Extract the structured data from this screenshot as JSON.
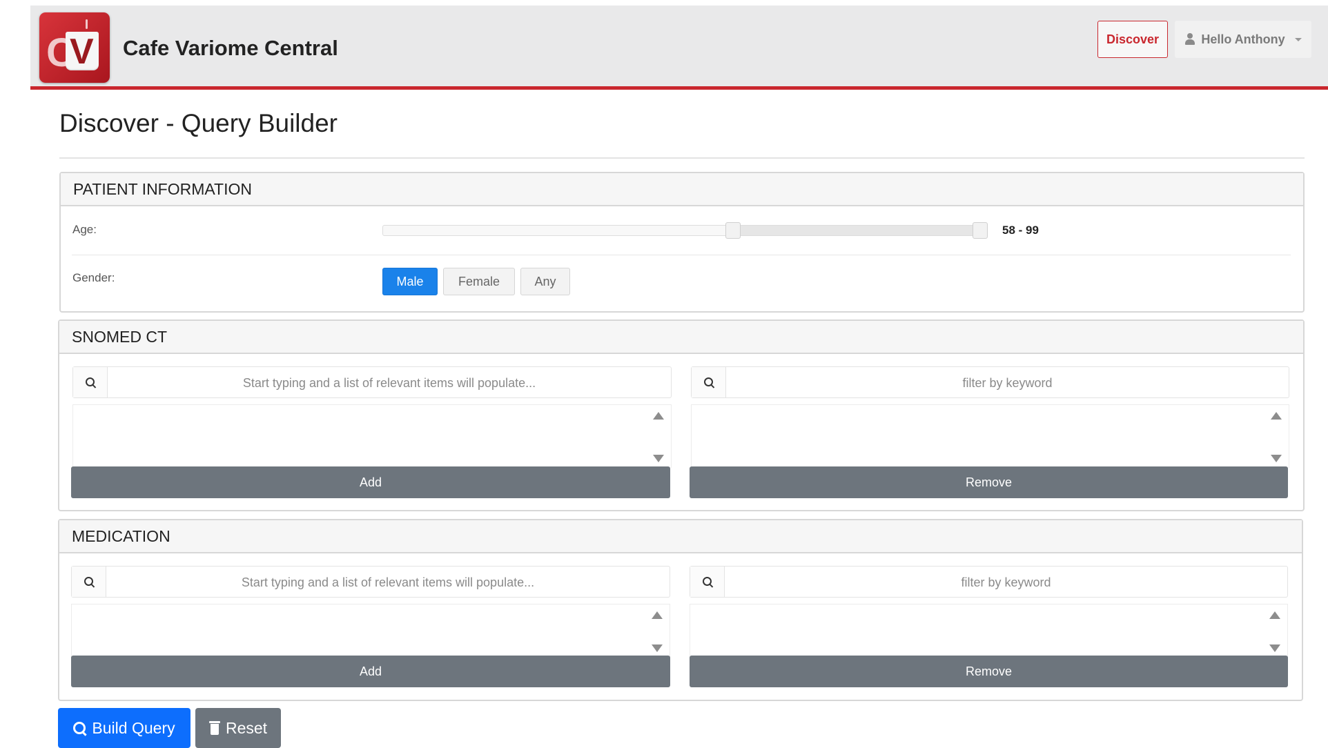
{
  "app": {
    "title": "Cafe Variome Central",
    "logo_text": "CV"
  },
  "navbar": {
    "discover_label": "Discover",
    "user_label": "Hello Anthony"
  },
  "page": {
    "title": "Discover - Query Builder"
  },
  "patient_info": {
    "header": "PATIENT INFORMATION",
    "age_label": "Age:",
    "age_min": 58,
    "age_max": 99,
    "slider_min": 0,
    "slider_max": 100,
    "age_value_text": "58 - 99",
    "gender_label": "Gender:",
    "gender_options": [
      "Male",
      "Female",
      "Any"
    ],
    "gender_selected": "Male"
  },
  "snomed": {
    "header": "SNOMED CT",
    "search_placeholder": "Start typing and a list of relevant items will populate...",
    "filter_placeholder": "filter by keyword",
    "add_label": "Add",
    "remove_label": "Remove"
  },
  "medication": {
    "header": "MEDICATION",
    "search_placeholder": "Start typing and a list of relevant items will populate...",
    "filter_placeholder": "filter by keyword",
    "add_label": "Add",
    "remove_label": "Remove"
  },
  "actions": {
    "build_query_label": "Build Query",
    "reset_label": "Reset"
  },
  "colors": {
    "brand_red": "#c9272e",
    "primary_blue": "#0d6efd",
    "secondary_gray": "#6d757d"
  },
  "icons": [
    "search-icon",
    "user-icon",
    "chevron-down-icon",
    "trash-icon"
  ]
}
